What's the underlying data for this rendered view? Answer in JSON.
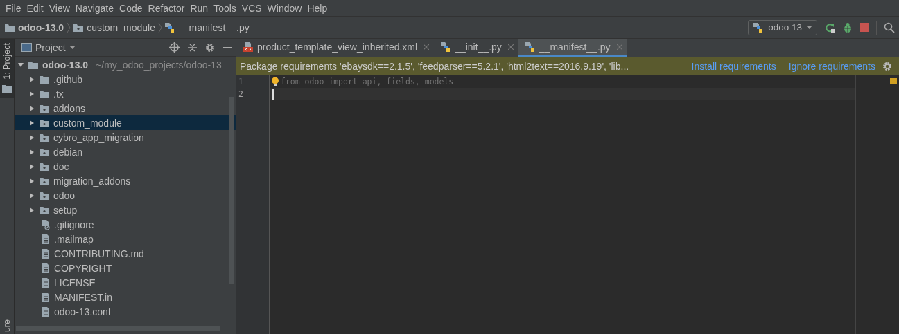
{
  "menu": [
    "File",
    "Edit",
    "View",
    "Navigate",
    "Code",
    "Refactor",
    "Run",
    "Tools",
    "VCS",
    "Window",
    "Help"
  ],
  "breadcrumbs": [
    {
      "kind": "root",
      "label": "odoo-13.0"
    },
    {
      "kind": "folder",
      "label": "custom_module"
    },
    {
      "kind": "python",
      "label": "__manifest__.py"
    }
  ],
  "run_config": {
    "label": "odoo 13"
  },
  "tool_strip": {
    "top": "1: Project",
    "bottom": "ure"
  },
  "project_panel": {
    "title": "Project",
    "root": {
      "label": "odoo-13.0",
      "path": "~/my_odoo_projects/odoo-13",
      "expanded": true,
      "children": [
        {
          "kind": "folder",
          "label": ".github",
          "expanded": false,
          "selected": false
        },
        {
          "kind": "folder",
          "label": ".tx",
          "expanded": false,
          "selected": false
        },
        {
          "kind": "module",
          "label": "addons",
          "expanded": false,
          "selected": false
        },
        {
          "kind": "module",
          "label": "custom_module",
          "expanded": false,
          "selected": true
        },
        {
          "kind": "module",
          "label": "cybro_app_migration",
          "expanded": false,
          "selected": false
        },
        {
          "kind": "module",
          "label": "debian",
          "expanded": false,
          "selected": false
        },
        {
          "kind": "module",
          "label": "doc",
          "expanded": false,
          "selected": false
        },
        {
          "kind": "module",
          "label": "migration_addons",
          "expanded": false,
          "selected": false
        },
        {
          "kind": "module",
          "label": "odoo",
          "expanded": false,
          "selected": false
        },
        {
          "kind": "module",
          "label": "setup",
          "expanded": false,
          "selected": false
        },
        {
          "kind": "ignore",
          "label": ".gitignore",
          "selected": false
        },
        {
          "kind": "file",
          "label": ".mailmap",
          "selected": false
        },
        {
          "kind": "file",
          "label": "CONTRIBUTING.md",
          "selected": false
        },
        {
          "kind": "file",
          "label": "COPYRIGHT",
          "selected": false
        },
        {
          "kind": "file",
          "label": "LICENSE",
          "selected": false
        },
        {
          "kind": "file",
          "label": "MANIFEST.in",
          "selected": false
        },
        {
          "kind": "file",
          "label": "odoo-13.conf",
          "selected": false
        }
      ]
    }
  },
  "tabs": [
    {
      "kind": "xml",
      "label": "product_template_view_inherited.xml",
      "selected": false
    },
    {
      "kind": "python",
      "label": "__init__.py",
      "selected": false
    },
    {
      "kind": "python",
      "label": "__manifest__.py",
      "selected": true
    }
  ],
  "notification": {
    "message": "Package requirements 'ebaysdk==2.1.5', 'feedparser==5.2.1', 'html2text==2016.9.19', 'lib...",
    "actions": [
      "Install requirements",
      "Ignore requirements"
    ]
  },
  "editor": {
    "lines": [
      {
        "number": "1",
        "text": "from odoo import api, fields, models"
      },
      {
        "number": "2"
      }
    ]
  }
}
